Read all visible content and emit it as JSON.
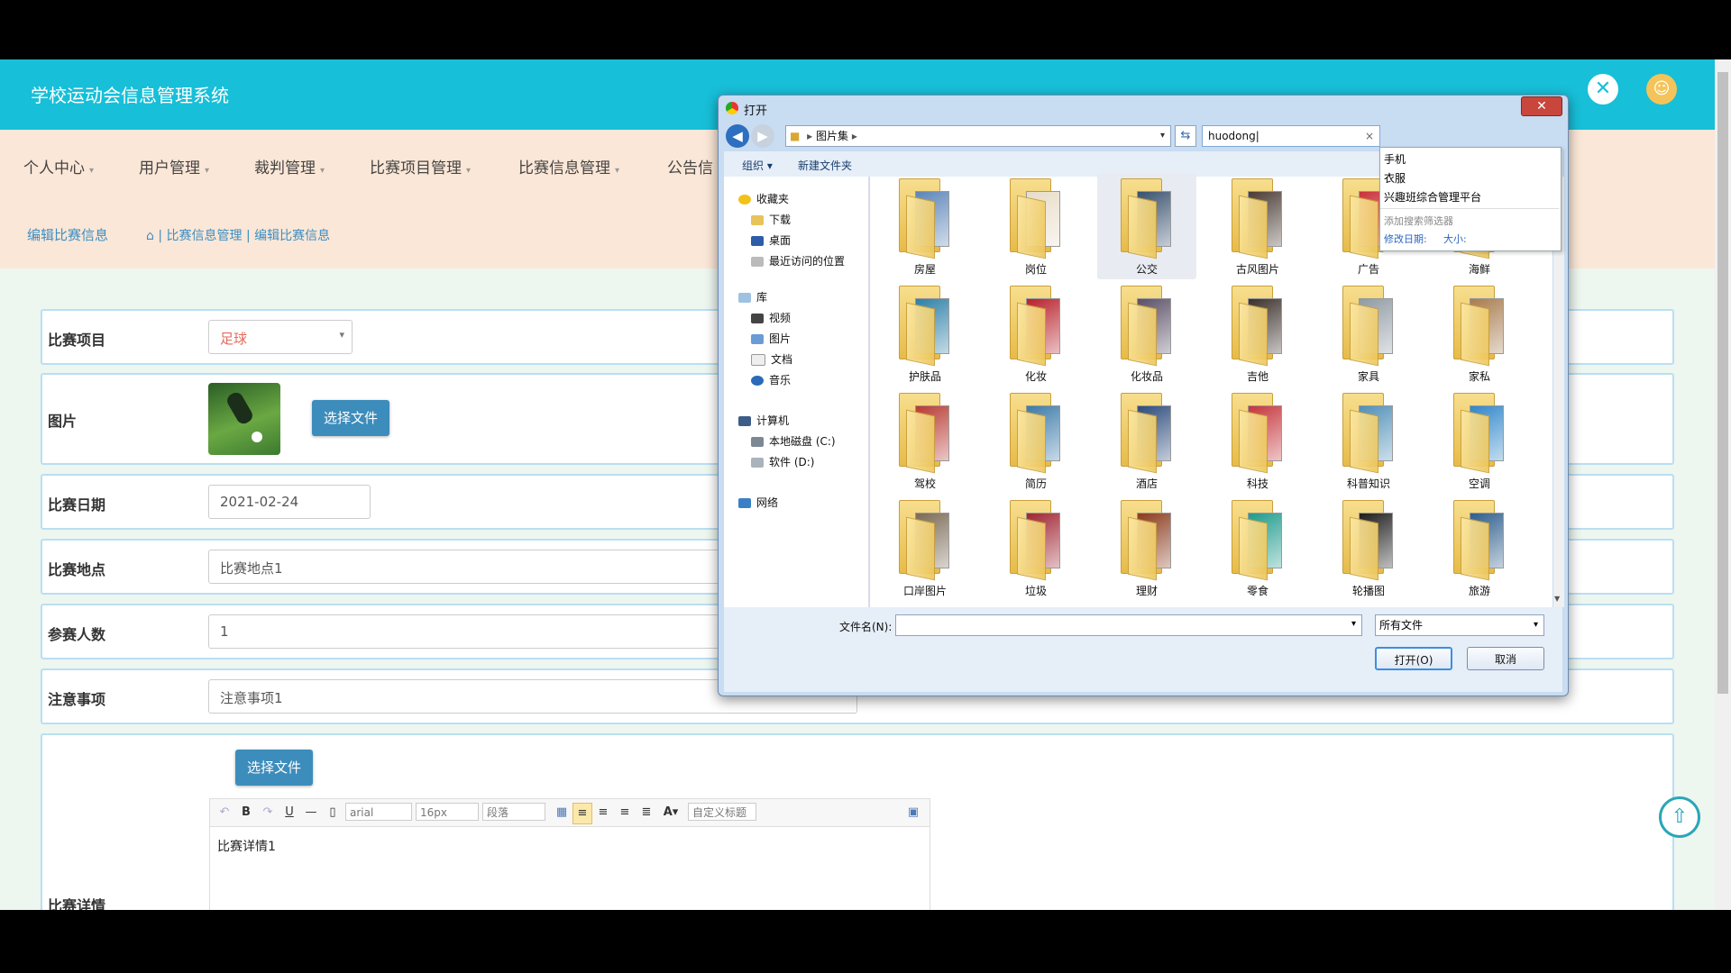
{
  "app": {
    "title": "学校运动会信息管理系统"
  },
  "nav": [
    {
      "label": "个人中心"
    },
    {
      "label": "用户管理"
    },
    {
      "label": "裁判管理"
    },
    {
      "label": "比赛项目管理"
    },
    {
      "label": "比赛信息管理"
    },
    {
      "label": "公告信"
    }
  ],
  "breadcrumb": {
    "title": "编辑比赛信息",
    "path": "| 比赛信息管理 | 编辑比赛信息"
  },
  "form": {
    "project": {
      "label": "比赛项目",
      "value": "足球"
    },
    "image": {
      "label": "图片",
      "button": "选择文件"
    },
    "date": {
      "label": "比赛日期",
      "value": "2021-02-24"
    },
    "location": {
      "label": "比赛地点",
      "value": "比赛地点1"
    },
    "count": {
      "label": "参赛人数",
      "value": "1"
    },
    "notes": {
      "label": "注意事项",
      "value": "注意事项1"
    },
    "details": {
      "label": "比赛详情",
      "button": "选择文件",
      "font": "arial",
      "size": "16px",
      "para": "段落",
      "custom": "自定义标题",
      "content": "比赛详情1"
    }
  },
  "dialog": {
    "title": "打开",
    "address": "图片集",
    "search_value": "huodong",
    "suggestions": [
      "手机",
      "衣服",
      "兴趣班综合管理平台"
    ],
    "add_filter": "添加搜索筛选器",
    "filter_date": "修改日期:",
    "filter_size": "大小:",
    "organize": "组织",
    "new_folder": "新建文件夹",
    "tree": {
      "favorites": "收藏夹",
      "downloads": "下载",
      "desktop": "桌面",
      "recent": "最近访问的位置",
      "libraries": "库",
      "videos": "视频",
      "pictures": "图片",
      "documents": "文档",
      "music": "音乐",
      "computer": "计算机",
      "disk_c": "本地磁盘 (C:)",
      "disk_d": "软件 (D:)",
      "network": "网络"
    },
    "folders": [
      {
        "name": "房屋",
        "color": "#5b84b8"
      },
      {
        "name": "岗位",
        "color": "#e8dcc7"
      },
      {
        "name": "公交",
        "color": "#37506e"
      },
      {
        "name": "古风图片",
        "color": "#4a3b34"
      },
      {
        "name": "广告",
        "color": "#c9303a"
      },
      {
        "name": "海鲜",
        "color": "#3d6b52"
      },
      {
        "name": "护肤品",
        "color": "#2d7fa6"
      },
      {
        "name": "化妆",
        "color": "#b7202a"
      },
      {
        "name": "化妆品",
        "color": "#5a4f66"
      },
      {
        "name": "吉他",
        "color": "#3a2f2a"
      },
      {
        "name": "家具",
        "color": "#8f9aa3"
      },
      {
        "name": "家私",
        "color": "#a87b4e"
      },
      {
        "name": "驾校",
        "color": "#b83a33"
      },
      {
        "name": "简历",
        "color": "#3d7aa8"
      },
      {
        "name": "酒店",
        "color": "#2c4a7c"
      },
      {
        "name": "科技",
        "color": "#c4353a"
      },
      {
        "name": "科普知识",
        "color": "#4f8fb8"
      },
      {
        "name": "空调",
        "color": "#2f86c9"
      },
      {
        "name": "口岸图片",
        "color": "#7a6a55"
      },
      {
        "name": "垃圾",
        "color": "#9e2432"
      },
      {
        "name": "理财",
        "color": "#8a3b1e"
      },
      {
        "name": "零食",
        "color": "#1f9a8c"
      },
      {
        "name": "轮播图",
        "color": "#1d1d1d"
      },
      {
        "name": "旅游",
        "color": "#2f5d8c"
      }
    ],
    "filename_label": "文件名(N):",
    "filename_value": "",
    "filetype": "所有文件",
    "open_button": "打开(O)",
    "cancel_button": "取消"
  }
}
